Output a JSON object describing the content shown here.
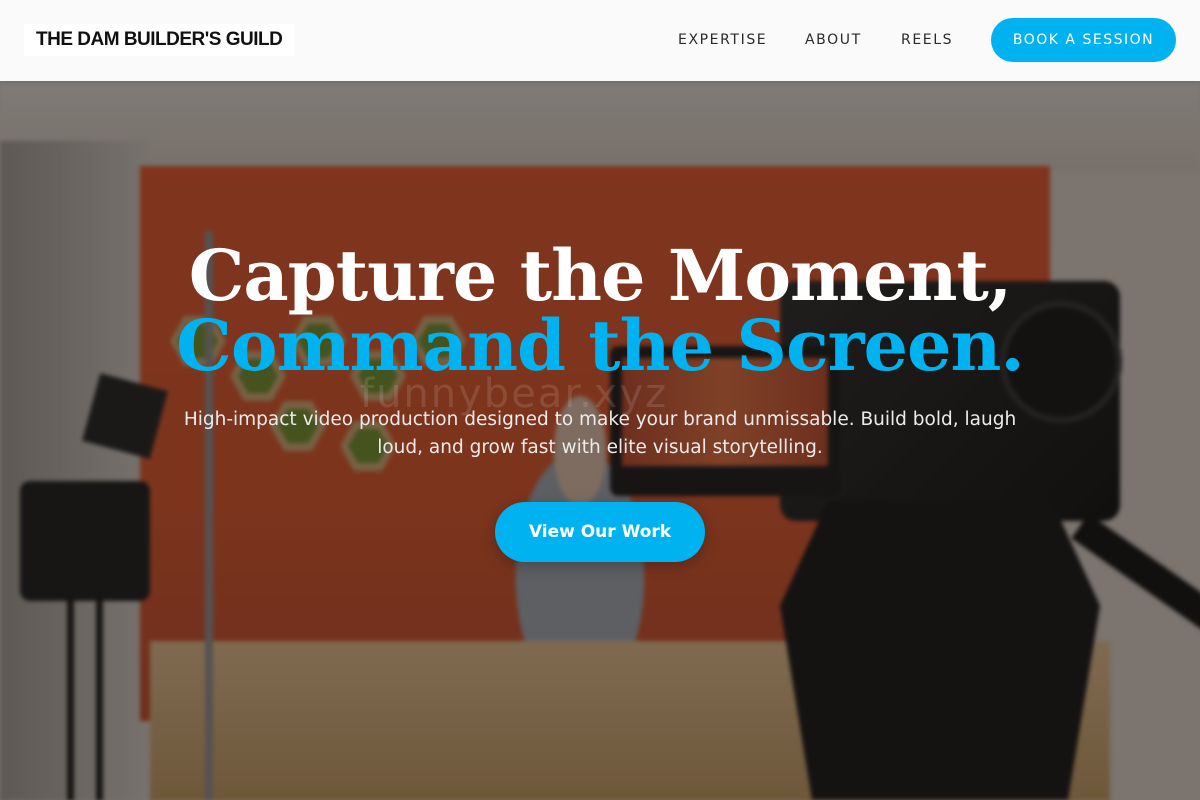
{
  "navbar": {
    "brand": "THE DAM BUILDER'S GUILD",
    "links": [
      {
        "label": "EXPERTISE"
      },
      {
        "label": "ABOUT"
      },
      {
        "label": "REELS"
      }
    ],
    "cta_label": "BOOK A SESSION"
  },
  "hero": {
    "headline_line1": "Capture the Moment,",
    "headline_line2": "Command the Screen.",
    "subtitle": "High-impact video production designed to make your brand unmissable. Build bold, laugh loud, and grow fast with elite visual storytelling.",
    "cta_label": "View Our Work",
    "watermark": "funnybear.xyz"
  },
  "colors": {
    "accent": "#00b3f0",
    "navbar_bg": "#fafafa",
    "headline_white": "#ffffff"
  }
}
